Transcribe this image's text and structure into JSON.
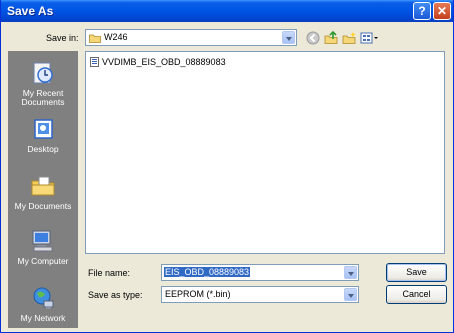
{
  "window": {
    "title": "Save As"
  },
  "toolbar": {
    "save_in_label": "Save in:",
    "save_in_value": "W246"
  },
  "places": [
    {
      "label": "My Recent Documents",
      "icon": "recent-documents-icon"
    },
    {
      "label": "Desktop",
      "icon": "desktop-icon"
    },
    {
      "label": "My Documents",
      "icon": "my-documents-icon"
    },
    {
      "label": "My Computer",
      "icon": "my-computer-icon"
    },
    {
      "label": "My Network",
      "icon": "my-network-icon"
    }
  ],
  "files": [
    {
      "name": "VVDIMB_EIS_OBD_08889083"
    }
  ],
  "form": {
    "file_name_label": "File name:",
    "file_name_value": "EIS_OBD_08889083",
    "save_type_label": "Save as type:",
    "save_type_value": "EEPROM (*.bin)"
  },
  "buttons": {
    "save": "Save",
    "cancel": "Cancel"
  },
  "colors": {
    "titlebar": "#0055e5",
    "face": "#ece9d8",
    "selection": "#316ac5"
  }
}
